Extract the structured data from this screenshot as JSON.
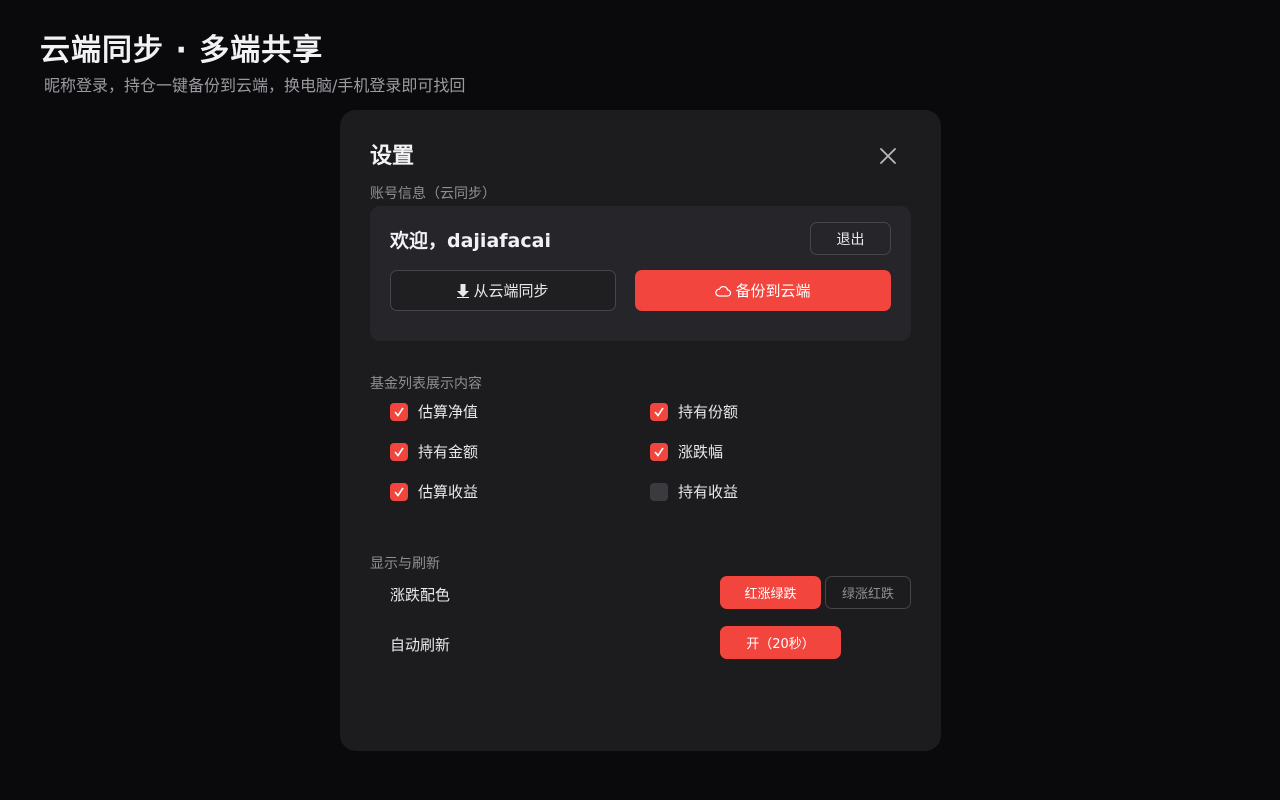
{
  "hero": {
    "title": "云端同步 · 多端共享",
    "subtitle": "昵称登录，持仓一键备份到云端，换电脑/手机登录即可找回"
  },
  "dialog": {
    "title": "设置",
    "close_icon": "close-icon"
  },
  "account": {
    "section_label": "账号信息（云同步）",
    "welcome": "欢迎，dajiafacai",
    "logout_label": "退出",
    "sync_label": "从云端同步",
    "sync_icon": "download-arrow-icon",
    "backup_label": "备份到云端",
    "backup_icon": "cloud-icon"
  },
  "fund_list": {
    "section_label": "基金列表展示内容",
    "options": [
      {
        "label": "估算净值",
        "checked": true
      },
      {
        "label": "持有份额",
        "checked": true
      },
      {
        "label": "持有金额",
        "checked": true
      },
      {
        "label": "涨跌幅",
        "checked": true
      },
      {
        "label": "估算收益",
        "checked": true
      },
      {
        "label": "持有收益",
        "checked": false
      }
    ]
  },
  "display": {
    "section_label": "显示与刷新",
    "color_label": "涨跌配色",
    "color_options": [
      "红涨绿跌",
      "绿涨红跌"
    ],
    "color_selected": "红涨绿跌",
    "refresh_label": "自动刷新",
    "refresh_value": "开（20秒）"
  },
  "colors": {
    "accent": "#f2453e",
    "background": "#0a0a0c",
    "dialog": "#1c1c1f",
    "card": "#26262a"
  }
}
